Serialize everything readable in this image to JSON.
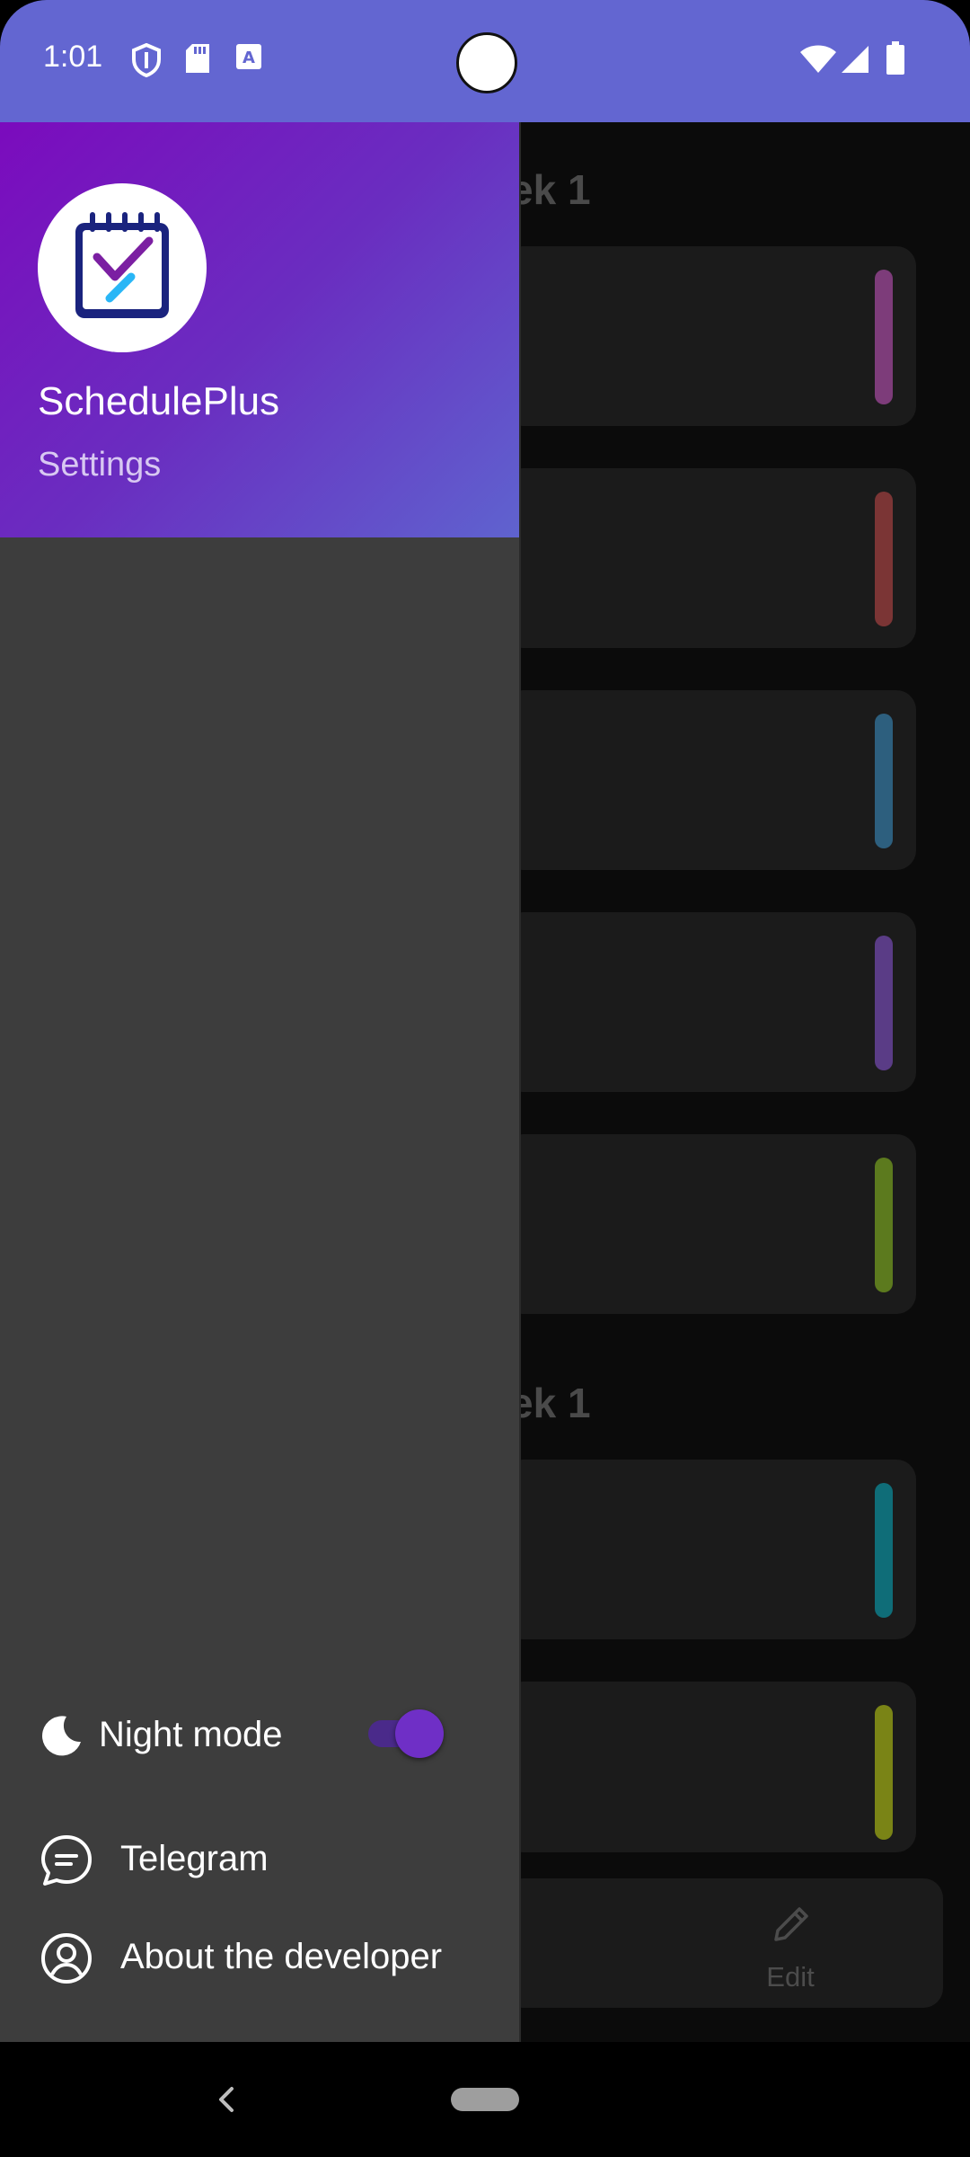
{
  "status_bar": {
    "time": "1:01",
    "icons": [
      "shield-icon",
      "sd-card-icon",
      "keyboard-a-icon",
      "wifi-icon",
      "signal-icon",
      "battery-icon"
    ],
    "color": "#6366d1"
  },
  "background_schedule": {
    "week_labels": [
      "ek 1",
      "ek 1"
    ],
    "cards": [
      {
        "accent": "#7d3c7a"
      },
      {
        "accent": "#7b3535"
      },
      {
        "accent": "#2d5f7e"
      },
      {
        "accent": "#5a3c86"
      },
      {
        "accent": "#5c7a1e"
      },
      {
        "accent": "#0f6d78"
      },
      {
        "accent": "#7a8416"
      }
    ],
    "edit_label": "Edit",
    "edit_icon": "pencil-icon"
  },
  "drawer": {
    "app_name": "SchedulePlus",
    "subtitle": "Settings",
    "logo_icon": "calendar-check-icon",
    "night_mode": {
      "label": "Night mode",
      "icon": "moon-icon",
      "enabled": true
    },
    "items": [
      {
        "label": "Telegram",
        "icon": "chat-bubble-icon"
      },
      {
        "label": "About the developer",
        "icon": "user-circle-icon"
      }
    ]
  },
  "nav_bar": {
    "icons": [
      "back-chevron-icon",
      "home-pill-icon"
    ]
  }
}
